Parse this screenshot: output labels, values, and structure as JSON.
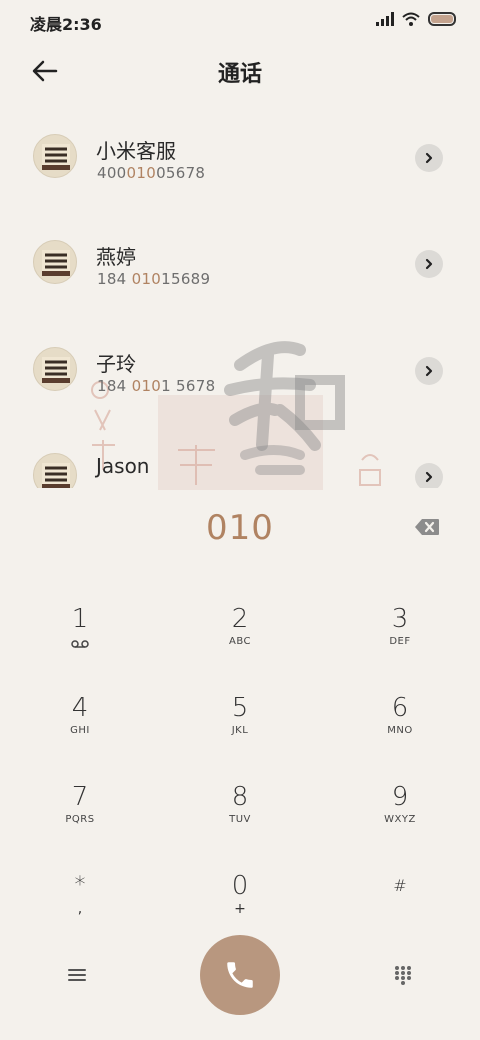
{
  "status_bar": {
    "time": "凌晨2:36",
    "signal_icon": "signal-icon",
    "wifi_icon": "wifi-icon",
    "battery_icon": "battery-icon"
  },
  "header": {
    "title": "通话",
    "back_icon": "arrow-left-icon"
  },
  "contacts": [
    {
      "name": "小米客服",
      "number_parts": [
        "400",
        "010",
        "05678"
      ]
    },
    {
      "name": "燕婷",
      "number_parts": [
        "184 ",
        "010",
        "15689"
      ]
    },
    {
      "name": "子玲",
      "number_parts": [
        "184 ",
        "010",
        "1 5678"
      ]
    },
    {
      "name": "Jason",
      "number_parts": [
        "",
        "",
        ""
      ]
    }
  ],
  "dial": {
    "number": "010",
    "backspace_icon": "backspace-icon"
  },
  "keypad": {
    "keys": [
      {
        "digit": "1",
        "sub": "voicemail-icon"
      },
      {
        "digit": "2",
        "sub": "ABC"
      },
      {
        "digit": "3",
        "sub": "DEF"
      },
      {
        "digit": "4",
        "sub": "GHI"
      },
      {
        "digit": "5",
        "sub": "JKL"
      },
      {
        "digit": "6",
        "sub": "MNO"
      },
      {
        "digit": "7",
        "sub": "PQRS"
      },
      {
        "digit": "8",
        "sub": "TUV"
      },
      {
        "digit": "9",
        "sub": "WXYZ"
      },
      {
        "digit": "*",
        "sub": ","
      },
      {
        "digit": "0",
        "sub": "+"
      },
      {
        "digit": "#",
        "sub": ""
      }
    ]
  },
  "bottom_bar": {
    "menu_icon": "menu-icon",
    "call_icon": "phone-icon",
    "keypad_icon": "dialpad-icon"
  },
  "colors": {
    "accent": "#b08362",
    "background": "#f4f1ec",
    "call_button": "#b8977f"
  }
}
